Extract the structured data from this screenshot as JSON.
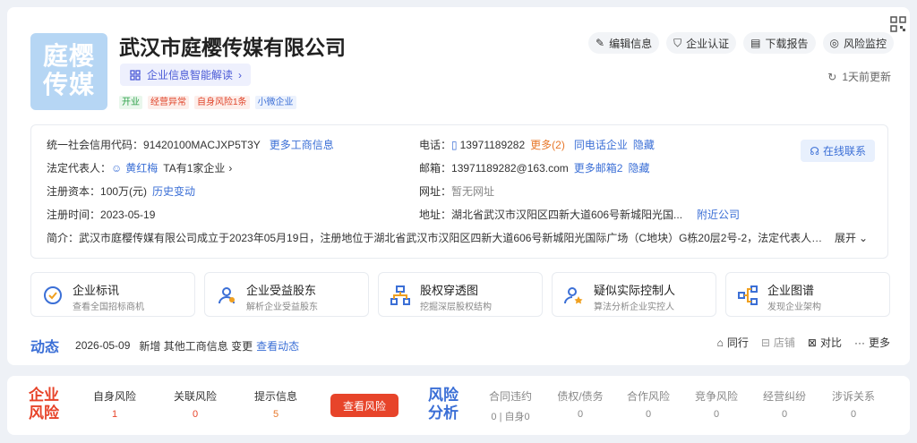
{
  "company": {
    "logo_text_1": "庭樱",
    "logo_text_2": "传媒",
    "name": "武汉市庭樱传媒有限公司",
    "ai_label": "企业信息智能解读",
    "tags": [
      "开业",
      "经营异常",
      "自身风险1条",
      "小微企业"
    ]
  },
  "actions": [
    "编辑信息",
    "企业认证",
    "下载报告",
    "风险监控"
  ],
  "update_text": "1天前更新",
  "info": {
    "credit_label": "统一社会信用代码：",
    "credit_value": "91420100MACJXP5T3Y",
    "credit_link": "更多工商信息",
    "rep_label": "法定代表人：",
    "rep_name": "黄红梅",
    "rep_suffix": "TA有1家企业",
    "capital_label": "注册资本：",
    "capital_value": "100万(元)",
    "capital_link": "历史变动",
    "date_label": "注册时间：",
    "date_value": "2023-05-19",
    "phone_label": "电话：",
    "phone_value": "13971189282",
    "phone_more": "更多(2)",
    "phone_same": "同电话企业",
    "phone_hide": "隐藏",
    "email_label": "邮箱：",
    "email_value": "13971189282@163.com",
    "email_more": "更多邮箱2",
    "email_hide": "隐藏",
    "web_label": "网址：",
    "web_value": "暂无网址",
    "addr_label": "地址：",
    "addr_value": "湖北省武汉市汉阳区四新大道606号新城阳光国...",
    "addr_link": "附近公司",
    "intro_label": "简介：",
    "intro_value": "武汉市庭樱传媒有限公司成立于2023年05月19日，注册地位于湖北省武汉市汉阳区四新大道606号新城阳光国际广场（C地块）G栋20层2号-2，法定代表人为黄...",
    "intro_expand": "展开",
    "online_contact": "在线联系"
  },
  "features": [
    {
      "title": "企业标讯",
      "sub": "查看全国招标商机",
      "icon": "bid-icon"
    },
    {
      "title": "企业受益股东",
      "sub": "解析企业受益股东",
      "icon": "shareholder-icon"
    },
    {
      "title": "股权穿透图",
      "sub": "挖掘深层股权结构",
      "icon": "equity-tree-icon"
    },
    {
      "title": "疑似实际控制人",
      "sub": "算法分析企业实控人",
      "icon": "controller-icon"
    },
    {
      "title": "企业图谱",
      "sub": "发现企业架构",
      "icon": "graph-icon"
    }
  ],
  "dynamic": {
    "title": "动态",
    "date": "2026-05-09",
    "text": "新增 其他工商信息 变更",
    "link": "查看动态",
    "peer": "同行",
    "shop": "店铺",
    "compare": "对比",
    "more": "更多"
  },
  "risk": {
    "company_risk_1": "企业",
    "company_risk_2": "风险",
    "self_label": "自身风险",
    "self_value": "1",
    "related_label": "关联风险",
    "related_value": "0",
    "hint_label": "提示信息",
    "hint_value": "5",
    "button": "查看风险",
    "analysis_1": "风险",
    "analysis_2": "分析",
    "contract_label": "合同违约",
    "contract_value": "0 | 自身0",
    "debt_label": "债权/债务",
    "debt_value": "0",
    "coop_label": "合作风险",
    "coop_value": "0",
    "compete_label": "竞争风险",
    "compete_value": "0",
    "business_label": "经营纠纷",
    "business_value": "0",
    "lawsuit_label": "涉诉关系",
    "lawsuit_value": "0"
  },
  "colors": {
    "accent": "#3b6fd6",
    "danger": "#e7442a",
    "warn": "#e7782b"
  }
}
